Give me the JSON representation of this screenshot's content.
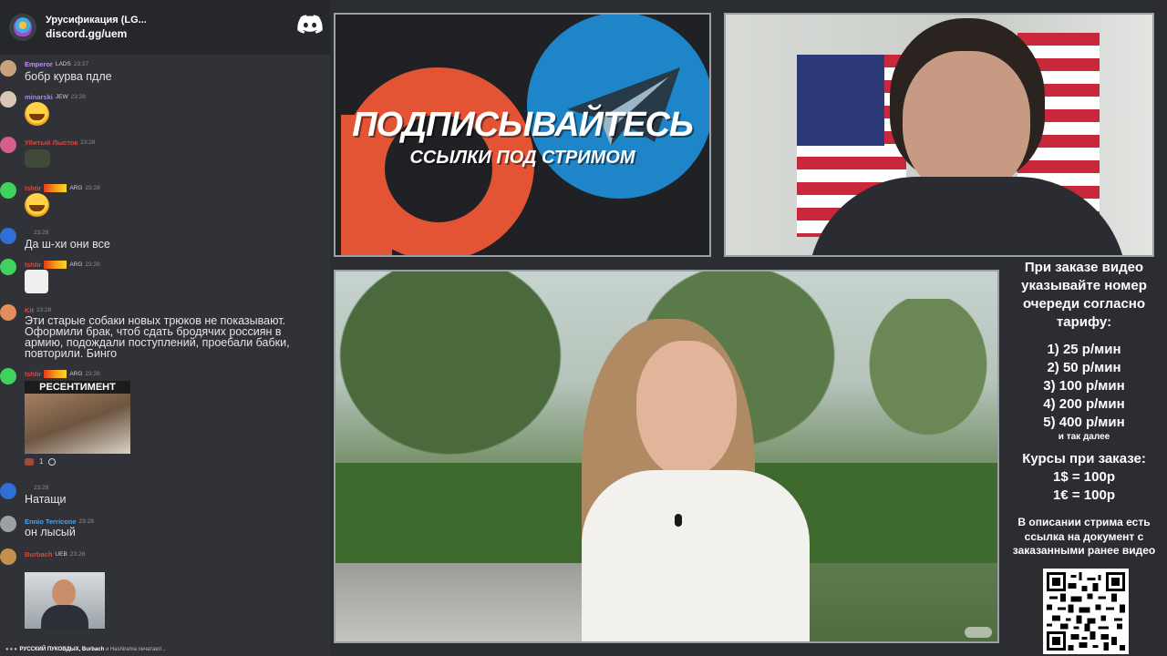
{
  "server": {
    "name": "Урусификация (LG...",
    "invite": "discord.gg/uem"
  },
  "messages": [
    {
      "user": "Emperor",
      "user_color": "#c08cff",
      "badges": [
        "LADS"
      ],
      "time": "23:27",
      "text": "бобр курва пдле"
    },
    {
      "user": "minarski",
      "user_color": "#a38de6",
      "badges": [
        "JEW"
      ],
      "time": "23:28",
      "emoji": "laughing-emoji"
    },
    {
      "user": "Убитый Лысток",
      "user_color": "#e0463b",
      "badges": [],
      "time": "23:28",
      "sticker": "frog-sticker"
    },
    {
      "user": "Ishtir",
      "user_color": "#e0463b",
      "badges": [
        "ARG"
      ],
      "time": "23:28",
      "emoji": "laughing-emoji"
    },
    {
      "user": "",
      "user_color": "#ffffff",
      "badges": [],
      "time": "23:28",
      "text": "Да ш-хи они все"
    },
    {
      "user": "Ishtir",
      "user_color": "#e0463b",
      "badges": [
        "ARG"
      ],
      "time": "23:28",
      "sticker": "cat-sticker"
    },
    {
      "user": "Kit",
      "user_color": "#e0463b",
      "badges": [],
      "time": "23:28",
      "text": "Эти старые собаки новых трюков не показывают. Оформили брак, чтоб сдать бродячих россиян в армию, подождали поступлений, проебали бабки, повторили. Бинго"
    },
    {
      "user": "Ishtir",
      "user_color": "#e0463b",
      "badges": [
        "ARG"
      ],
      "time": "23:28",
      "image_caption": "РЕСЕНТИМЕНТ",
      "reaction_count": "1"
    },
    {
      "user": "",
      "user_color": "#ffffff",
      "badges": [],
      "time": "23:28",
      "text": "Натащи"
    },
    {
      "user": "Ennio Terricone",
      "user_color": "#4fa3e6",
      "badges": [],
      "time": "23:28",
      "text": "он лысый"
    },
    {
      "user": "Burbach",
      "user_color": "#e0463b",
      "badges": [
        "UEB"
      ],
      "time": "23:28",
      "image": "webcam-photo"
    }
  ],
  "typing": {
    "users": "РУССКИЙ ПУКОВДЫХ, Burbach",
    "rest": " и Hashirama печатают..."
  },
  "banner": {
    "title": "ПОДПИСЫВАЙТЕСЬ",
    "subtitle": "ССЫЛКИ ПОД СТРИМОМ"
  },
  "info": {
    "intro": "При заказе видео указывайте номер очереди согласно тарифу:",
    "prices": [
      "1) 25 р/мин",
      "2) 50 р/мин",
      "3) 100 р/мин",
      "4) 200 р/мин",
      "5) 400 р/мин"
    ],
    "etc": "и так далее",
    "rates_title": "Курсы при заказе:",
    "rates": [
      "1$ = 100р",
      "1€ = 100р"
    ],
    "desc": "В описании стрима есть ссылка на документ с заказанными ранее видео"
  },
  "colors": {
    "telegram": "#1e86c8",
    "patreon": "#e35435",
    "chat_bg": "#303237",
    "header_bg": "#26272b"
  }
}
